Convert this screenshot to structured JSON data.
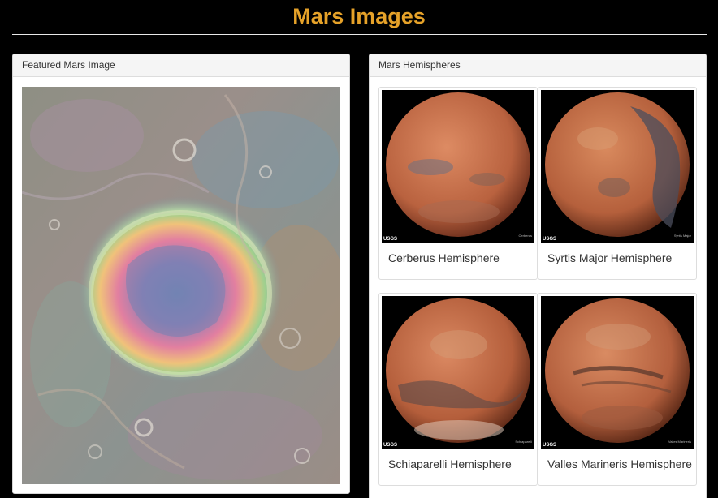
{
  "header": {
    "title": "Mars Images"
  },
  "featured": {
    "heading": "Featured Mars Image",
    "image_alt": "Featured Mars crater image"
  },
  "hemispheres": {
    "heading": "Mars Hemispheres",
    "items": [
      {
        "title": "Cerberus Hemisphere",
        "logo": "USGS",
        "tag": "Cerberus"
      },
      {
        "title": "Syrtis Major Hemisphere",
        "logo": "USGS",
        "tag": "Syrtis Major"
      },
      {
        "title": "Schiaparelli Hemisphere",
        "logo": "USGS",
        "tag": "Schiaparelli"
      },
      {
        "title": "Valles Marineris Hemisphere",
        "logo": "USGS",
        "tag": "Valles Marineris"
      }
    ]
  },
  "colors": {
    "title": "#e6a229",
    "background": "#000000",
    "mars": "#c1633c"
  }
}
